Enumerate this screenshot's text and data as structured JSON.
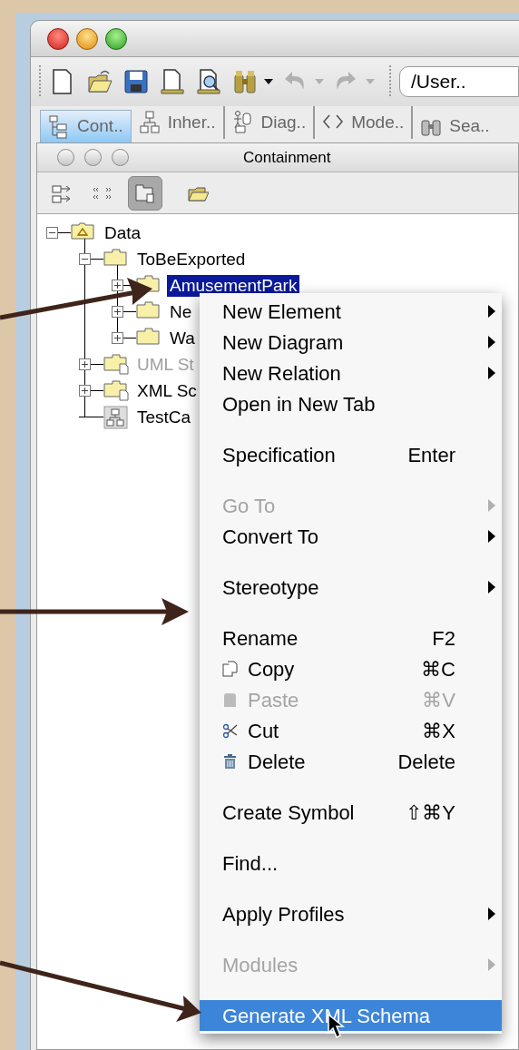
{
  "toolbar": {
    "buttons": [
      {
        "kind": "new",
        "disabled": false
      },
      {
        "kind": "open",
        "disabled": false
      },
      {
        "kind": "save",
        "disabled": false
      },
      {
        "kind": "page",
        "disabled": false
      },
      {
        "kind": "preview",
        "disabled": false
      },
      {
        "kind": "find",
        "disabled": false
      },
      {
        "kind": "caret",
        "disabled": false
      },
      {
        "kind": "undo",
        "disabled": true
      },
      {
        "kind": "caret",
        "disabled": true
      },
      {
        "kind": "redo",
        "disabled": true
      },
      {
        "kind": "caret",
        "disabled": true
      }
    ],
    "path": "/User.."
  },
  "tabs": [
    {
      "label": "Cont..",
      "kind": "containment",
      "selected": true
    },
    {
      "label": "Inher..",
      "kind": "inheritance",
      "selected": false
    },
    {
      "label": "Diag..",
      "kind": "diagrams",
      "selected": false
    },
    {
      "label": "Mode..",
      "kind": "model",
      "selected": false
    },
    {
      "label": "Sea..",
      "kind": "search",
      "selected": false
    }
  ],
  "panel": {
    "title": "Containment",
    "tools": [
      {
        "kind": "expand",
        "selected": false
      },
      {
        "kind": "stereotypes",
        "selected": false
      },
      {
        "kind": "packages",
        "selected": true
      },
      {
        "kind": "open",
        "selected": false
      }
    ]
  },
  "tree": [
    {
      "label": "Data",
      "kind": "model",
      "expanded": true,
      "selected": false,
      "disabled": false,
      "children": [
        {
          "label": "ToBeExported",
          "kind": "package",
          "expanded": true,
          "selected": false,
          "disabled": false,
          "children": [
            {
              "label": "AmusementPark",
              "kind": "package",
              "expanded": false,
              "selected": true,
              "disabled": false
            },
            {
              "label": "Ne",
              "kind": "package",
              "expanded": false,
              "selected": false,
              "disabled": false
            },
            {
              "label": "Wa",
              "kind": "package",
              "expanded": false,
              "selected": false,
              "disabled": false
            }
          ]
        },
        {
          "label": "UML St",
          "kind": "profile",
          "expanded": false,
          "selected": false,
          "disabled": true
        },
        {
          "label": "XML Sc",
          "kind": "profile",
          "expanded": false,
          "selected": false,
          "disabled": false
        },
        {
          "label": "TestCa",
          "kind": "diagram",
          "selected": false,
          "disabled": false
        }
      ]
    }
  ],
  "menu": {
    "groups": [
      [
        {
          "label": "New Element",
          "kind": "plain",
          "submenu": true,
          "disabled": false,
          "selected": false
        },
        {
          "label": "New Diagram",
          "kind": "plain",
          "submenu": true,
          "disabled": false,
          "selected": false
        },
        {
          "label": "New Relation",
          "kind": "plain",
          "submenu": true,
          "disabled": false,
          "selected": false
        },
        {
          "label": "Open in New Tab",
          "kind": "plain",
          "submenu": false,
          "disabled": false,
          "selected": false
        }
      ],
      [
        {
          "label": "Specification",
          "shortcut": "Enter",
          "kind": "plain",
          "submenu": false,
          "disabled": false,
          "selected": false
        }
      ],
      [
        {
          "label": "Go To",
          "kind": "plain",
          "submenu": true,
          "disabled": true,
          "selected": false
        },
        {
          "label": "Convert To",
          "kind": "plain",
          "submenu": true,
          "disabled": false,
          "selected": false
        }
      ],
      [
        {
          "label": "Stereotype",
          "kind": "plain",
          "submenu": true,
          "disabled": false,
          "selected": false
        }
      ],
      [
        {
          "label": "Rename",
          "shortcut": "F2",
          "kind": "plain",
          "submenu": false,
          "disabled": false,
          "selected": false
        },
        {
          "label": "Copy",
          "shortcut": "⌘C",
          "kind": "copy",
          "submenu": false,
          "disabled": false,
          "selected": false
        },
        {
          "label": "Paste",
          "shortcut": "⌘V",
          "kind": "paste",
          "submenu": false,
          "disabled": true,
          "selected": false
        },
        {
          "label": "Cut",
          "shortcut": "⌘X",
          "kind": "cut",
          "submenu": false,
          "disabled": false,
          "selected": false
        },
        {
          "label": "Delete",
          "shortcut": "Delete",
          "kind": "delete",
          "submenu": false,
          "disabled": false,
          "selected": false
        }
      ],
      [
        {
          "label": "Create Symbol",
          "shortcut": "⇧⌘Y",
          "kind": "plain",
          "submenu": false,
          "disabled": false,
          "selected": false
        }
      ],
      [
        {
          "label": "Find...",
          "kind": "plain",
          "submenu": false,
          "disabled": false,
          "selected": false
        }
      ],
      [
        {
          "label": "Apply Profiles",
          "kind": "plain",
          "submenu": true,
          "disabled": false,
          "selected": false
        }
      ],
      [
        {
          "label": "Modules",
          "kind": "plain",
          "submenu": true,
          "disabled": true,
          "selected": false
        }
      ],
      [
        {
          "label": "Generate XML Schema",
          "kind": "plain",
          "submenu": false,
          "disabled": false,
          "selected": true
        }
      ]
    ]
  }
}
